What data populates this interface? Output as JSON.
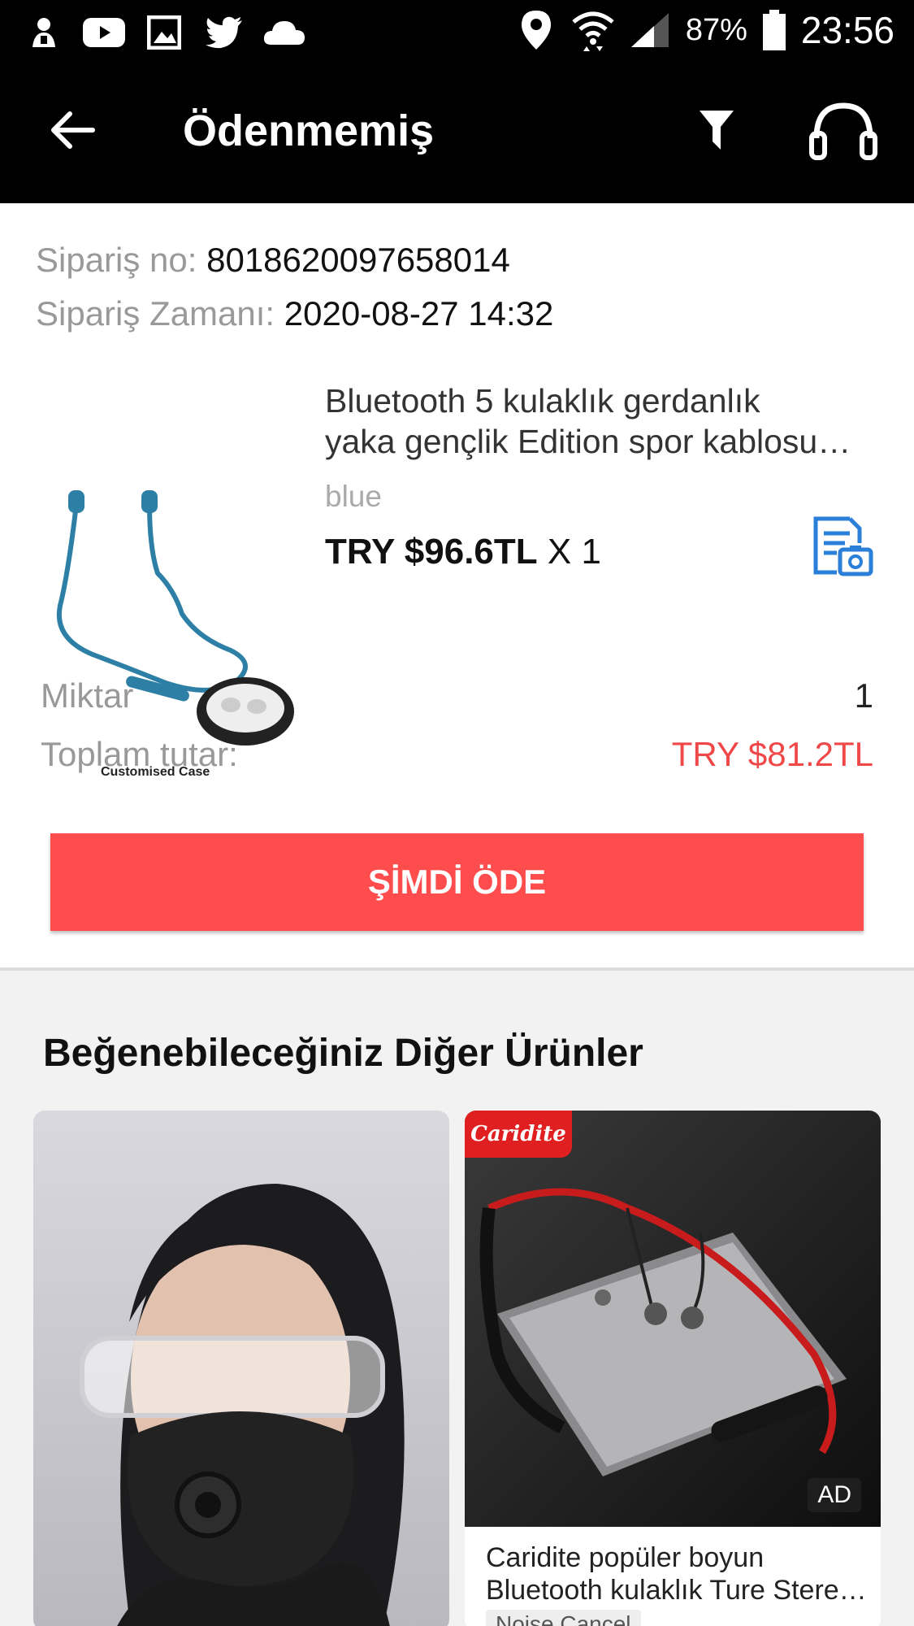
{
  "status_bar": {
    "battery_percent": "87%",
    "time": "23:56",
    "left_icons": [
      "android-debug-icon",
      "youtube-icon",
      "gallery-icon",
      "twitter-icon",
      "cloud-icon"
    ],
    "right_icons": [
      "location-icon",
      "wifi-icon",
      "signal-icon",
      "battery-icon"
    ]
  },
  "app_bar": {
    "title": "Ödenmemiş"
  },
  "order": {
    "order_no_label": "Sipariş no:",
    "order_no_value": "8018620097658014",
    "order_time_label": "Sipariş Zamanı:",
    "order_time_value": "2020-08-27 14:32",
    "product": {
      "title_line1": "Bluetooth 5 kulaklık gerdanlık",
      "title_line2": "yaka gençlik Edition spor kablosu…",
      "variant": "blue",
      "price": "TRY $96.6TL",
      "quantity_text": "X 1",
      "image_caption": "Customised Case"
    },
    "quantity_label": "Miktar",
    "quantity_value": "1",
    "total_label": "Toplam tutar:",
    "total_value": "TRY $81.2TL",
    "pay_button": "ŞİMDİ ÖDE"
  },
  "recommendations": {
    "title": "Beğenebileceğiniz Diğer Ürünler",
    "items": [
      {
        "name_line1": "",
        "name_line2": "",
        "ad": ""
      },
      {
        "brand": "Caridite",
        "name_line1": "Caridite popüler boyun",
        "name_line2": "Bluetooth kulaklık Ture Stere…",
        "ad": "AD",
        "tag": "Noise Cancel"
      }
    ]
  },
  "colors": {
    "accent_red": "#ff4c4c",
    "total_red": "#f04848",
    "icon_blue": "#2a7fd8",
    "app_bar": "#000000"
  }
}
